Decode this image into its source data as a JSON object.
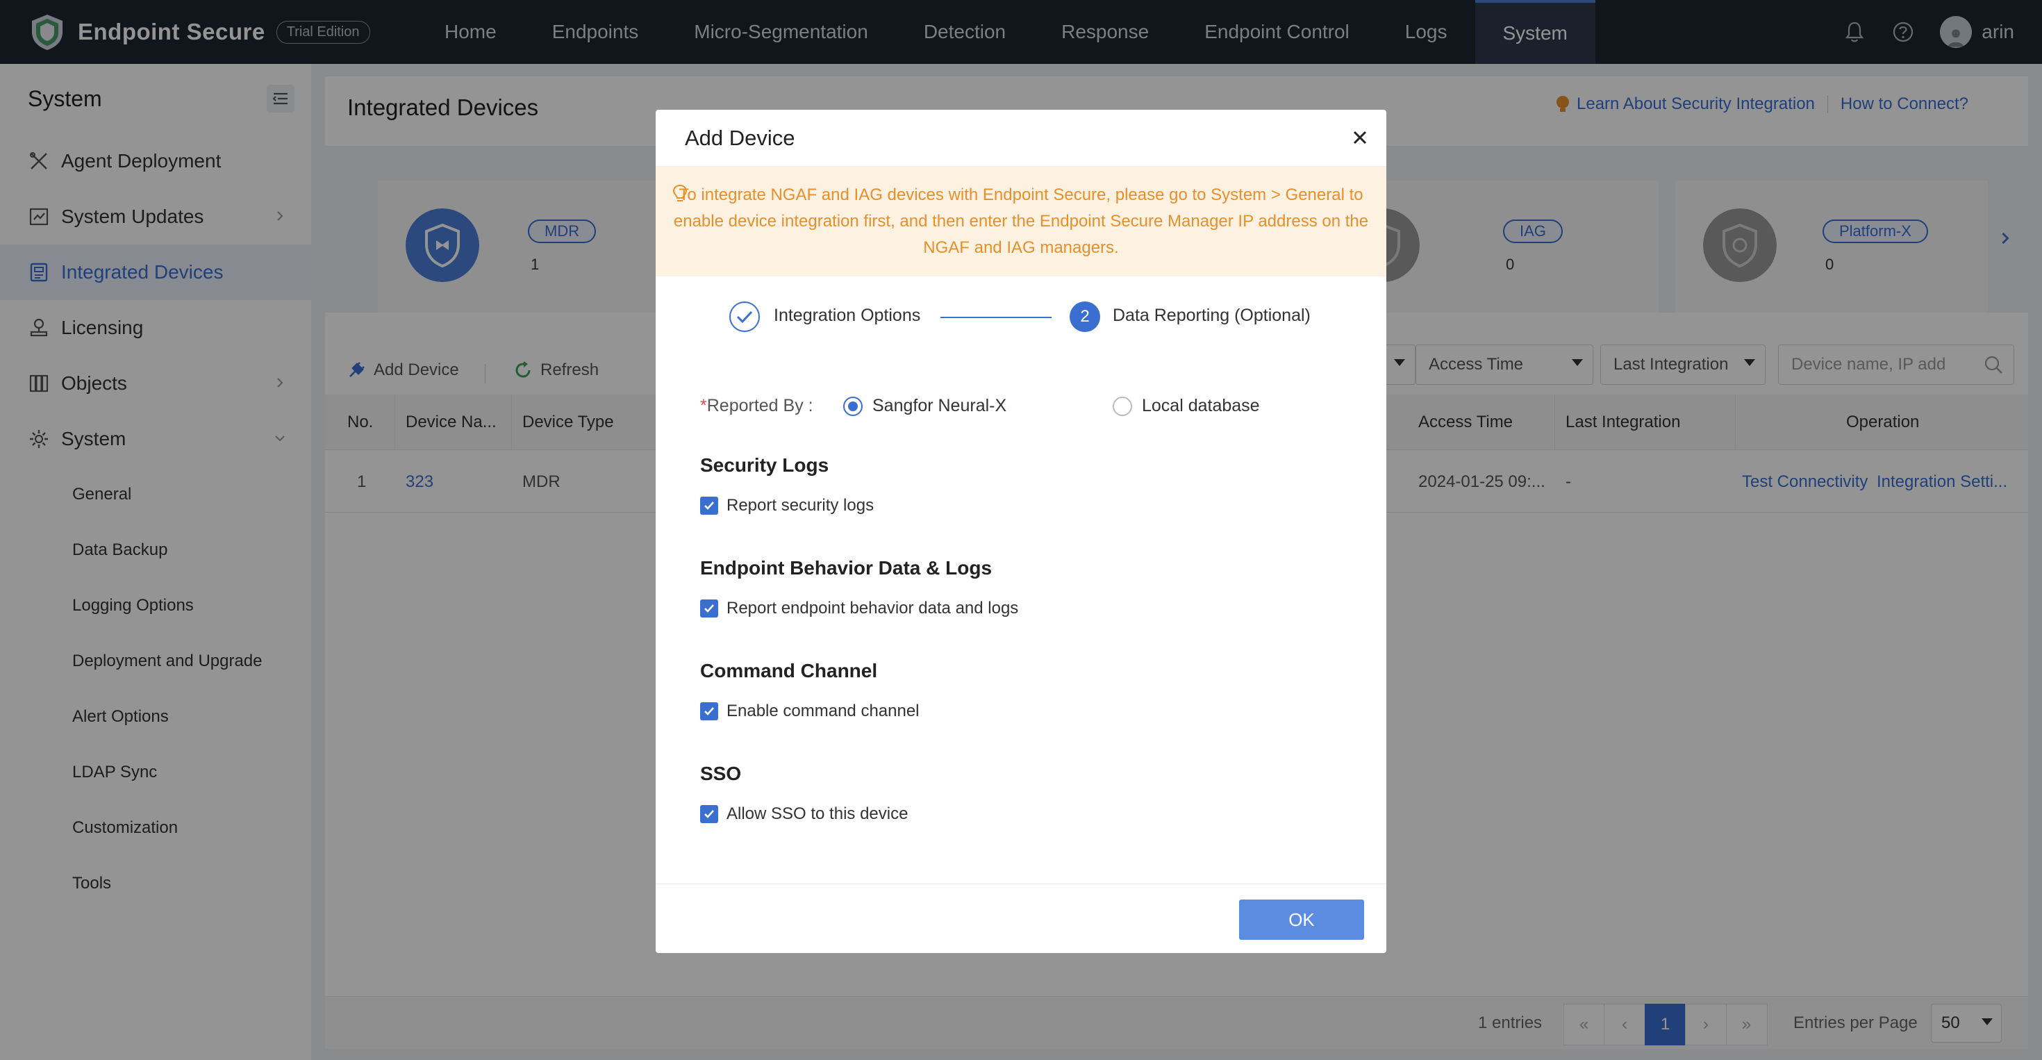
{
  "brand": {
    "name": "Endpoint Secure",
    "edition": "Trial Edition"
  },
  "nav": {
    "items": [
      "Home",
      "Endpoints",
      "Micro-Segmentation",
      "Detection",
      "Response",
      "Endpoint Control",
      "Logs",
      "System"
    ],
    "active": "System"
  },
  "user": {
    "name": "arin"
  },
  "sidebar": {
    "title": "System",
    "items": [
      {
        "label": "Agent Deployment",
        "icon": "tools-icon"
      },
      {
        "label": "System Updates",
        "icon": "updates-icon"
      },
      {
        "label": "Integrated Devices",
        "icon": "devices-icon"
      },
      {
        "label": "Licensing",
        "icon": "licensing-icon"
      },
      {
        "label": "Objects",
        "icon": "objects-icon"
      },
      {
        "label": "System",
        "icon": "gear-icon"
      }
    ],
    "subitems": [
      "General",
      "Data Backup",
      "Logging Options",
      "Deployment and Upgrade",
      "Alert Options",
      "LDAP Sync",
      "Customization",
      "Tools"
    ]
  },
  "main": {
    "title": "Integrated Devices",
    "link_learn": "Learn About Security Integration",
    "link_connect": "How to Connect?",
    "cards": [
      {
        "tag": "MDR",
        "count": "1"
      },
      {
        "tag": "IAG",
        "count": "0"
      },
      {
        "tag": "Platform-X",
        "count": "0"
      }
    ],
    "toolbar": {
      "add": "Add Device",
      "refresh": "Refresh"
    },
    "filters": {
      "access_time": "Access Time",
      "last_integration": "Last Integration",
      "search_placeholder": "Device name, IP add"
    },
    "table": {
      "headers": {
        "no": "No.",
        "name": "Device Na...",
        "type": "Device Type",
        "access": "Access Time",
        "last": "Last Integration",
        "op": "Operation"
      },
      "row": {
        "no": "1",
        "name": "323",
        "type": "MDR",
        "access": "2024-01-25 09:...",
        "last": "-",
        "op1": "Test Connectivity",
        "op2": "Integration Setti..."
      }
    },
    "footer": {
      "entries": "1 entries",
      "page": "1",
      "epp_label": "Entries per Page",
      "epp_value": "50"
    }
  },
  "modal": {
    "title": "Add Device",
    "notice": "To integrate NGAF and IAG devices with Endpoint Secure, please go to System > General to enable device integration first, and then enter the Endpoint Secure Manager IP address on the NGAF and IAG managers.",
    "step1": "Integration Options",
    "step2_num": "2",
    "step2": "Data Reporting (Optional)",
    "reported_by_label": "Reported By :",
    "req_mark": "*",
    "radio1": "Sangfor Neural-X",
    "radio2": "Local database",
    "sections": [
      {
        "title": "Security Logs",
        "checkbox": "Report security logs"
      },
      {
        "title": "Endpoint Behavior Data & Logs",
        "checkbox": "Report endpoint behavior data and logs"
      },
      {
        "title": "Command Channel",
        "checkbox": "Enable command channel"
      },
      {
        "title": "SSO",
        "checkbox": "Allow SSO to this device"
      }
    ],
    "ok": "OK"
  },
  "colors": {
    "accent": "#3a6fd0",
    "nav_bg": "#1e2633",
    "notice_text": "#e7902b",
    "notice_bg": "#fdf1e2"
  }
}
